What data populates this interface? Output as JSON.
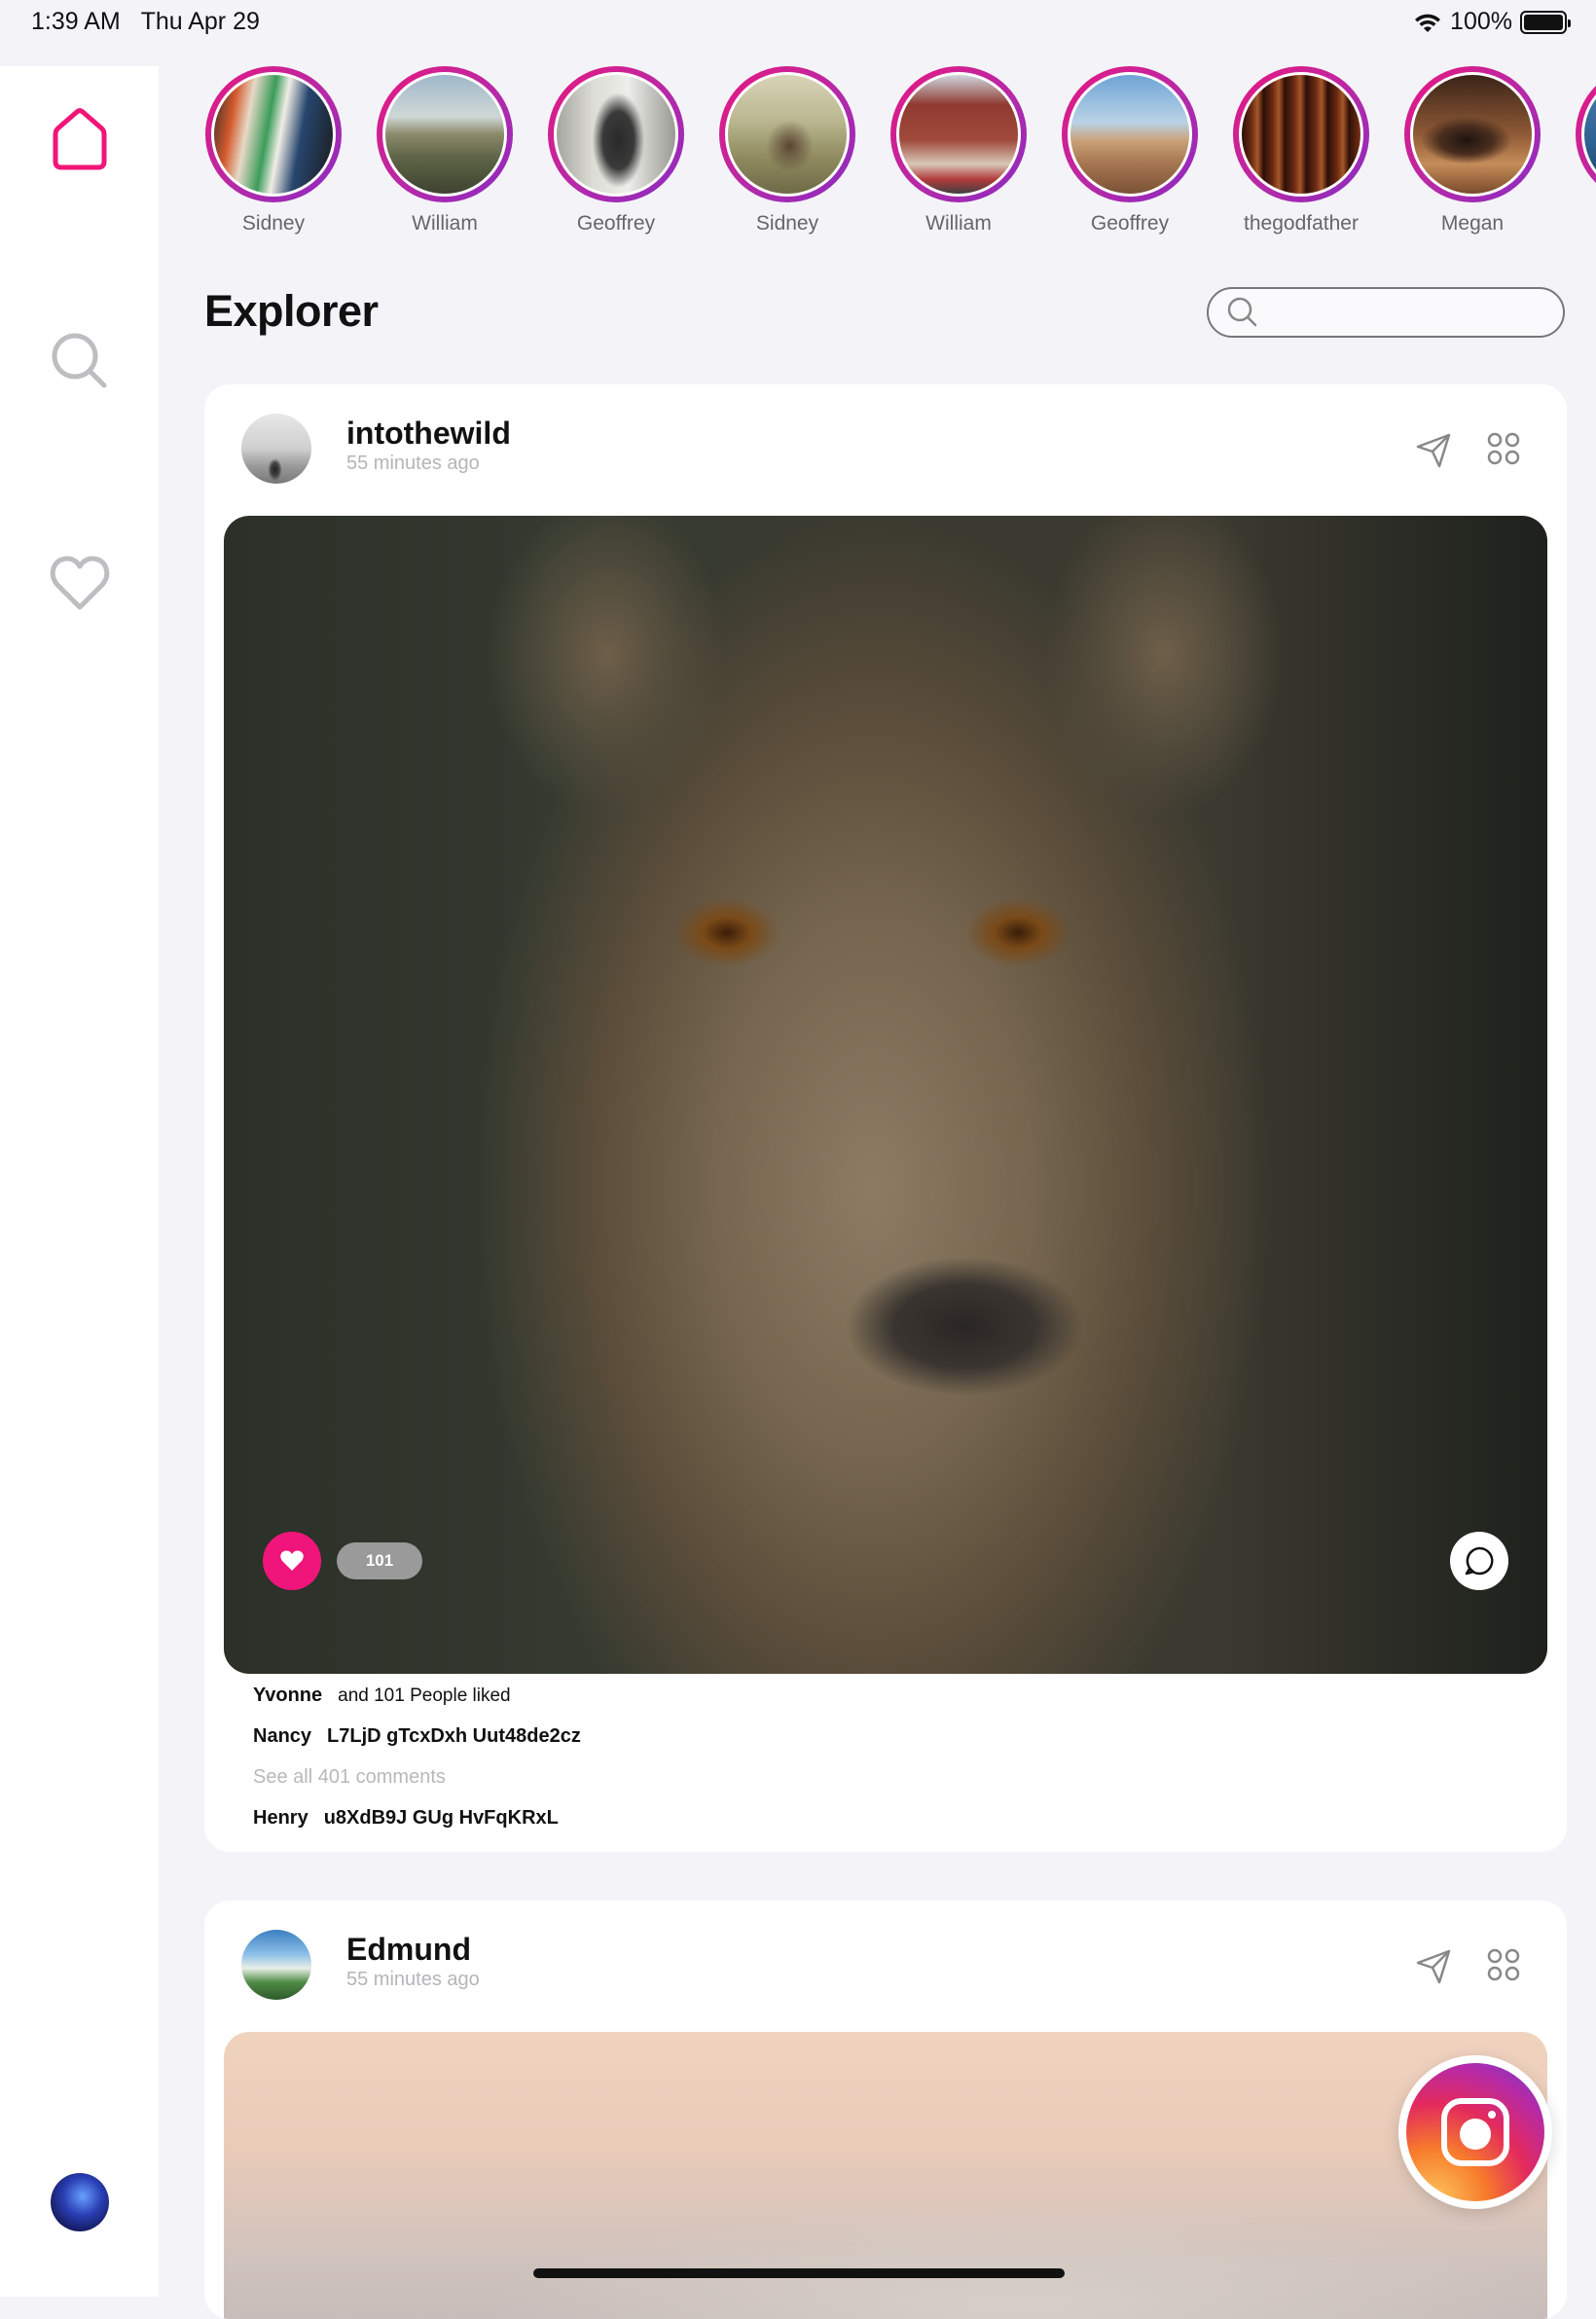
{
  "status_bar": {
    "time": "1:39 AM",
    "date": "Thu Apr 29",
    "battery": "100%",
    "battery_level": 1.0
  },
  "sidebar": {
    "items": [
      {
        "icon": "home-icon",
        "active": true
      },
      {
        "icon": "search-icon",
        "active": false
      },
      {
        "icon": "heart-icon",
        "active": false
      }
    ],
    "profile_avatar": "avatar"
  },
  "stories": [
    {
      "name": "Sidney"
    },
    {
      "name": "William"
    },
    {
      "name": "Geoffrey"
    },
    {
      "name": "Sidney"
    },
    {
      "name": "William"
    },
    {
      "name": "Geoffrey"
    },
    {
      "name": "thegodfather"
    },
    {
      "name": "Megan"
    },
    {
      "name": ""
    }
  ],
  "page": {
    "title": "Explorer",
    "search_placeholder": ""
  },
  "posts": [
    {
      "username": "intothewild",
      "time": "55 minutes ago",
      "likes_badge": "101",
      "liked_by_user": "Yvonne",
      "liked_by_text": "and 101 People liked",
      "comment1_user": "Nancy",
      "comment1_text": "L7LjD gTcxDxh Uut48de2cz",
      "see_all": "See all 401 comments",
      "comment2_user": "Henry",
      "comment2_text": "u8XdB9J GUg HvFqKRxL"
    },
    {
      "username": "Edmund",
      "time": "55 minutes ago"
    }
  ],
  "colors": {
    "accent": "#f0157a",
    "story_ring_start": "#e8177f",
    "story_ring_end": "#8a2bc2",
    "background": "#f4f4f8"
  }
}
